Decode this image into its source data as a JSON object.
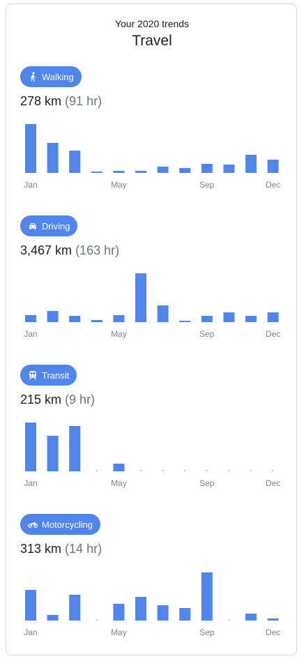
{
  "header": {
    "subtitle": "Your 2020 trends",
    "title": "Travel"
  },
  "colors": {
    "bar": "#5085ee",
    "chip": "#5085ee",
    "dot": "#9aa0a6"
  },
  "chart_data": [
    {
      "type": "bar",
      "activity": "Walking",
      "icon": "walking-icon",
      "distance": "278 km",
      "hours": "(91 hr)",
      "categories": [
        "Jan",
        "Feb",
        "Mar",
        "Apr",
        "May",
        "Jun",
        "Jul",
        "Aug",
        "Sep",
        "Oct",
        "Nov",
        "Dec"
      ],
      "tick_labels": [
        "Jan",
        "May",
        "Sep",
        "Dec"
      ],
      "values": [
        70,
        43,
        32,
        2,
        3,
        3,
        9,
        7,
        13,
        12,
        26,
        19
      ],
      "ylim": [
        0,
        70
      ]
    },
    {
      "type": "bar",
      "activity": "Driving",
      "icon": "car-icon",
      "distance": "3,467 km",
      "hours": "(163 hr)",
      "categories": [
        "Jan",
        "Feb",
        "Mar",
        "Apr",
        "May",
        "Jun",
        "Jul",
        "Aug",
        "Sep",
        "Oct",
        "Nov",
        "Dec"
      ],
      "tick_labels": [
        "Jan",
        "May",
        "Sep",
        "Dec"
      ],
      "values": [
        10,
        16,
        9,
        3,
        10,
        70,
        24,
        2,
        9,
        14,
        9,
        14
      ],
      "ylim": [
        0,
        70
      ]
    },
    {
      "type": "bar",
      "activity": "Transit",
      "icon": "train-icon",
      "distance": "215 km",
      "hours": "(9 hr)",
      "categories": [
        "Jan",
        "Feb",
        "Mar",
        "Apr",
        "May",
        "Jun",
        "Jul",
        "Aug",
        "Sep",
        "Oct",
        "Nov",
        "Dec"
      ],
      "tick_labels": [
        "Jan",
        "May",
        "Sep",
        "Dec"
      ],
      "values": [
        70,
        51,
        65,
        0,
        11,
        0,
        0,
        0,
        0,
        0,
        0,
        0
      ],
      "ylim": [
        0,
        70
      ]
    },
    {
      "type": "bar",
      "activity": "Motorcycling",
      "icon": "motorcycle-icon",
      "distance": "313 km",
      "hours": "(14 hr)",
      "categories": [
        "Jan",
        "Feb",
        "Mar",
        "Apr",
        "May",
        "Jun",
        "Jul",
        "Aug",
        "Sep",
        "Oct",
        "Nov",
        "Dec"
      ],
      "tick_labels": [
        "Jan",
        "May",
        "Sep",
        "Dec"
      ],
      "values": [
        44,
        8,
        37,
        0,
        24,
        34,
        22,
        18,
        69,
        0,
        10,
        3
      ],
      "ylim": [
        0,
        70
      ]
    }
  ]
}
